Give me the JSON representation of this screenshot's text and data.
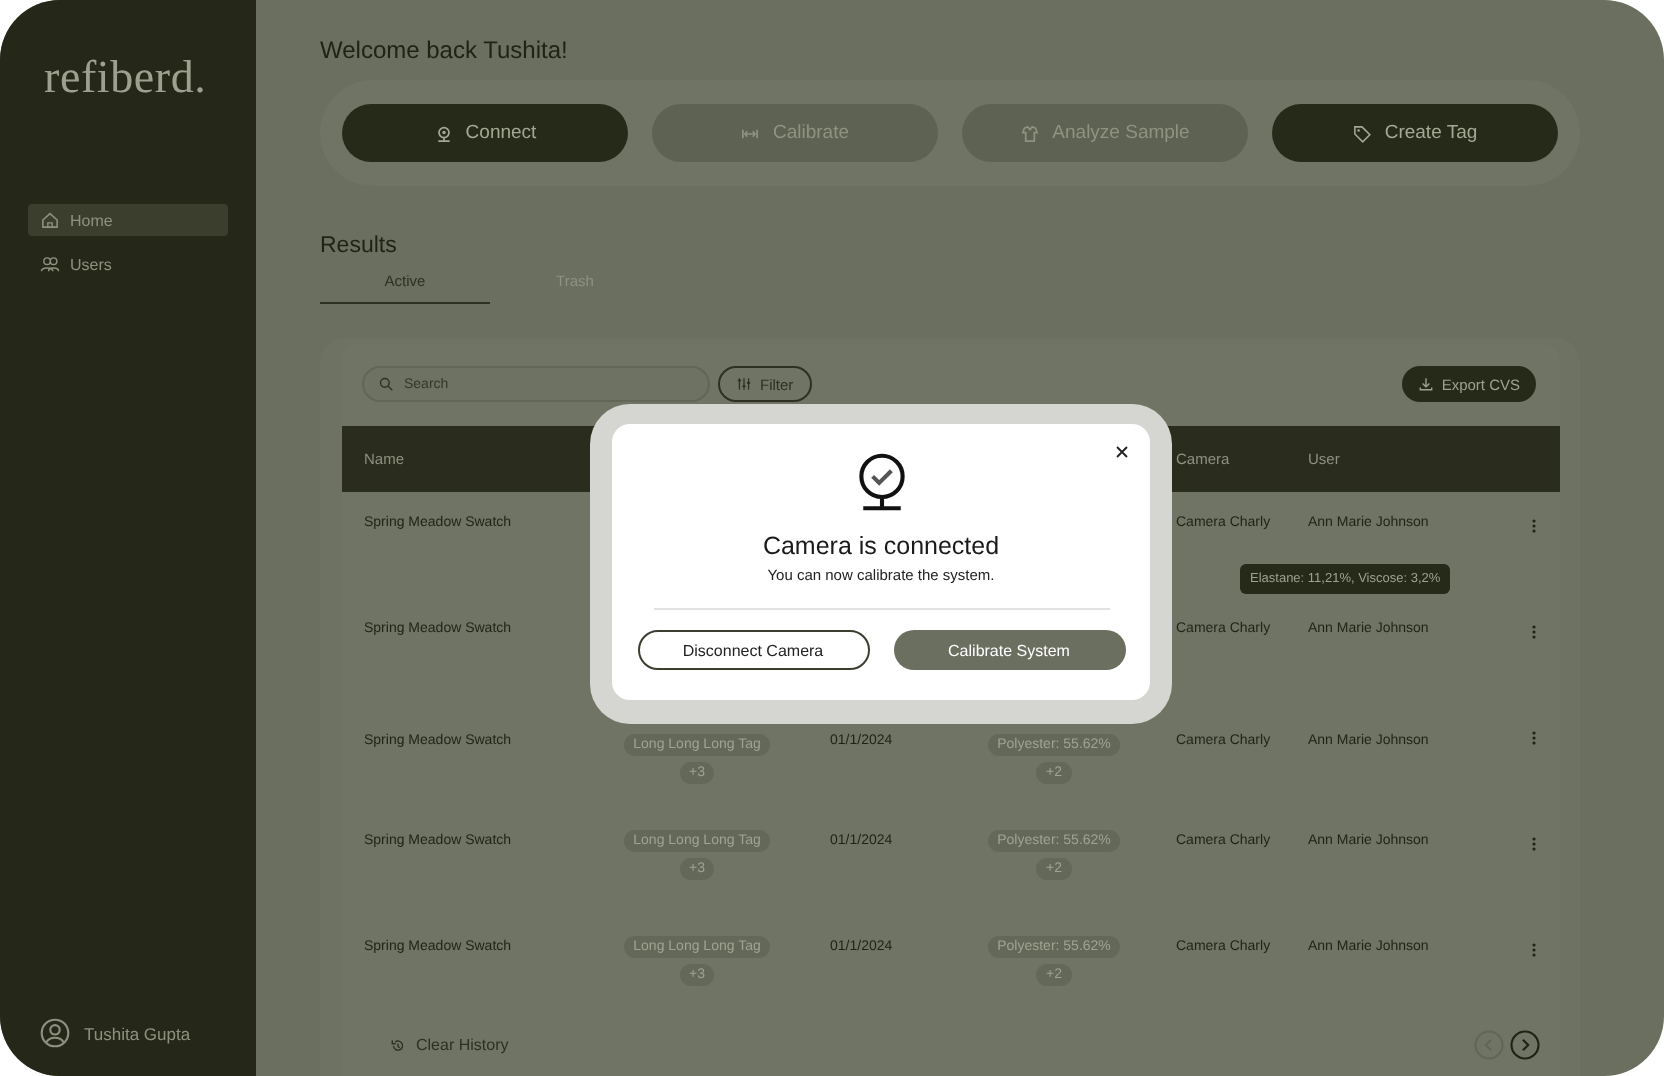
{
  "sidebar": {
    "logo": "refiberd.",
    "items": [
      {
        "kind": "home",
        "label": "Home",
        "selected": true
      },
      {
        "kind": "users",
        "label": "Users",
        "selected": false
      }
    ],
    "user": "Tushita Gupta"
  },
  "greeting": "Welcome back Tushita!",
  "actions": [
    {
      "kind": "connect",
      "label": "Connect",
      "disabled": false
    },
    {
      "kind": "calibrate",
      "label": "Calibrate",
      "disabled": true
    },
    {
      "kind": "analyze",
      "label": "Analyze Sample",
      "disabled": true
    },
    {
      "kind": "tag",
      "label": "Create Tag",
      "disabled": false
    }
  ],
  "results": {
    "title": "Results",
    "tabs": [
      {
        "label": "Active",
        "selected": true
      },
      {
        "label": "Trash",
        "selected": false
      }
    ],
    "search": {
      "placeholder": "Search"
    },
    "filter": "Filter",
    "export": "Export CVS",
    "columns": {
      "name": "Name",
      "camera": "Camera",
      "user": "User"
    },
    "rows": [
      {
        "name": "Spring Meadow Swatch",
        "camera": "Camera Charly",
        "user": "Ann Marie Johnson"
      },
      {
        "name": "Spring Meadow Swatch",
        "camera": "Camera Charly",
        "user": "Ann Marie Johnson"
      },
      {
        "name": "Spring Meadow Swatch",
        "tag": "Long Long Long Tag",
        "tag_more": "+3",
        "date": "01/1/2024",
        "composition": "Polyester: 55.62%",
        "composition_more": "+2",
        "camera": "Camera Charly",
        "user": "Ann Marie Johnson"
      },
      {
        "name": "Spring Meadow Swatch",
        "tag": "Long Long Long Tag",
        "tag_more": "+3",
        "date": "01/1/2024",
        "composition": "Polyester: 55.62%",
        "composition_more": "+2",
        "camera": "Camera Charly",
        "user": "Ann Marie Johnson"
      },
      {
        "name": "Spring Meadow Swatch",
        "tag": "Long Long Long Tag",
        "tag_more": "+3",
        "date": "01/1/2024",
        "composition": "Polyester: 55.62%",
        "composition_more": "+2",
        "camera": "Camera Charly",
        "user": "Ann Marie Johnson"
      }
    ],
    "tooltip": "Elastane: 11,21%, Viscose: 3,2%",
    "clear": "Clear History",
    "pagination": [
      {
        "kind": "prev",
        "disabled": true
      },
      {
        "kind": "next",
        "disabled": false
      }
    ]
  },
  "modal": {
    "title": "Camera is connected",
    "message": "You can now calibrate the system.",
    "buttons": [
      {
        "kind": "outline",
        "label": "Disconnect Camera"
      },
      {
        "kind": "filled",
        "label": "Calibrate System"
      }
    ]
  }
}
